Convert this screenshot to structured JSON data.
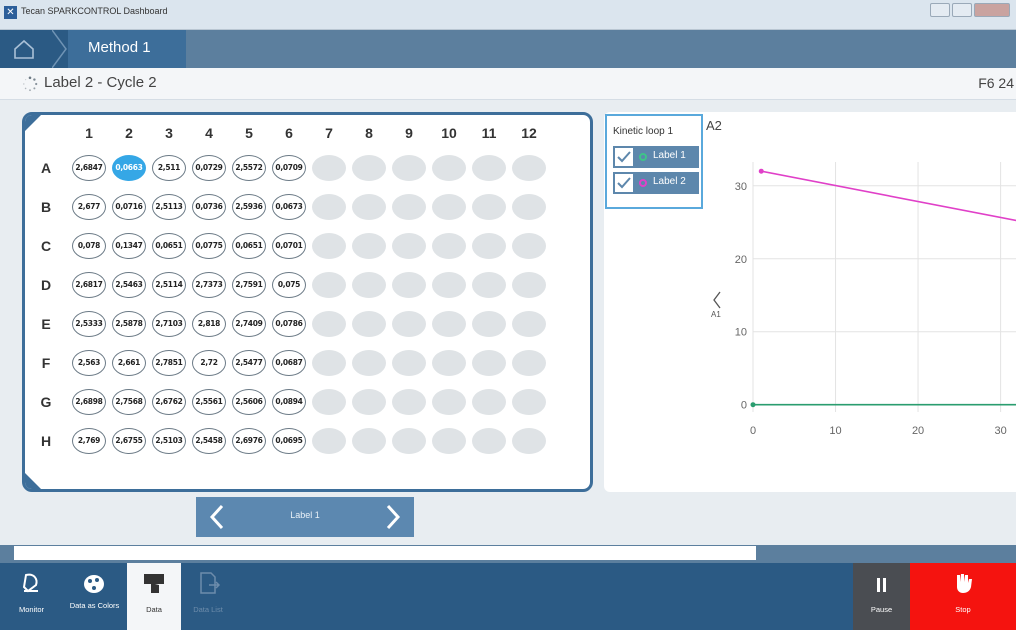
{
  "window": {
    "title": "Tecan SPARKCONTROL Dashboard"
  },
  "nav": {
    "method_label": "Method 1"
  },
  "header": {
    "status_label": "Label 2 - Cycle 2",
    "right_label": "F6 24"
  },
  "plate": {
    "columns": [
      "1",
      "2",
      "3",
      "4",
      "5",
      "6",
      "7",
      "8",
      "9",
      "10",
      "11",
      "12"
    ],
    "rows": [
      "A",
      "B",
      "C",
      "D",
      "E",
      "F",
      "G",
      "H"
    ],
    "values": [
      [
        "2,6847",
        "0,0663",
        "2,511",
        "0,0729",
        "2,5572",
        "0,0709"
      ],
      [
        "2,677",
        "0,0716",
        "2,5113",
        "0,0736",
        "2,5936",
        "0,0673"
      ],
      [
        "0,078",
        "0,1347",
        "0,0651",
        "0,0775",
        "0,0651",
        "0,0701"
      ],
      [
        "2,6817",
        "2,5463",
        "2,5114",
        "2,7373",
        "2,7591",
        "0,075"
      ],
      [
        "2,5333",
        "2,5878",
        "2,7103",
        "2,818",
        "2,7409",
        "0,0786"
      ],
      [
        "2,563",
        "2,661",
        "2,7851",
        "2,72",
        "2,5477",
        "0,0687"
      ],
      [
        "2,6898",
        "2,7568",
        "2,6762",
        "2,5561",
        "2,5606",
        "0,0894"
      ],
      [
        "2,769",
        "2,6755",
        "2,5103",
        "2,5458",
        "2,6976",
        "0,0695"
      ]
    ],
    "selected": {
      "row": 0,
      "col": 1
    }
  },
  "pager": {
    "label": "Label 1"
  },
  "legend": {
    "title": "Kinetic loop 1",
    "items": [
      {
        "label": "Label 1",
        "color": "#3fc489",
        "checked": true
      },
      {
        "label": "Label 2",
        "color": "#e040c8",
        "checked": true
      }
    ]
  },
  "chart_data": {
    "type": "line",
    "title": "A2",
    "ylabel": "A1",
    "xlim": [
      0,
      32
    ],
    "ylim": [
      -1,
      36
    ],
    "xticks": [
      0,
      10,
      20,
      30
    ],
    "yticks": [
      0,
      10,
      20,
      30
    ],
    "grid": true,
    "series": [
      {
        "name": "Label 2",
        "color": "#e040c8",
        "x": [
          1,
          33
        ],
        "y": [
          32,
          25
        ]
      },
      {
        "name": "Label 1",
        "color": "#2a9d6f",
        "x": [
          0,
          33
        ],
        "y": [
          0,
          0
        ]
      }
    ]
  },
  "progress": {
    "fraction": 0.73
  },
  "toolbar": {
    "monitor": "Monitor",
    "data_as_colors": "Data as Colors",
    "data": "Data",
    "disabled_label": "Data List",
    "pause": "Pause",
    "stop": "Stop"
  }
}
